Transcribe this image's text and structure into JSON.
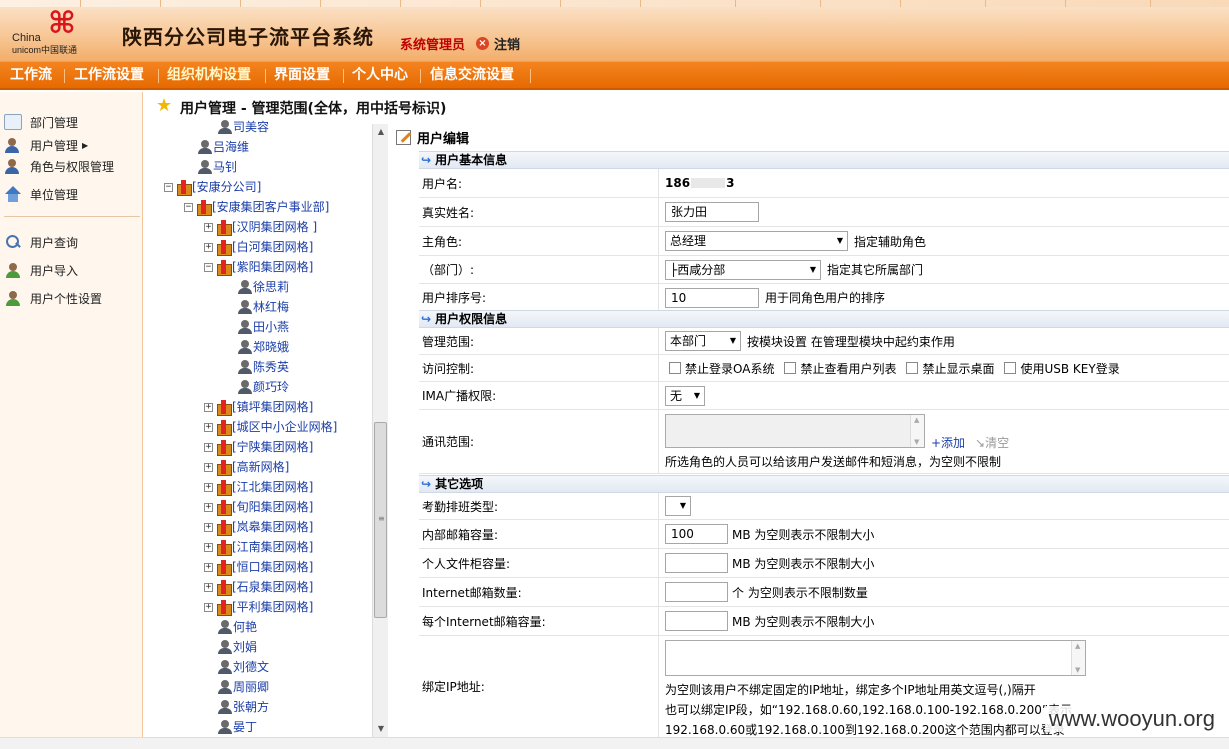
{
  "app": {
    "logo_text_1": "China",
    "logo_text_2": "unicom中国联通",
    "title": "陕西分公司电子流平台系统",
    "role": "系统管理员",
    "logout": "注销"
  },
  "menu": [
    {
      "label": "工作流",
      "active": false
    },
    {
      "label": "工作流设置",
      "active": false
    },
    {
      "label": "组织机构设置",
      "active": true
    },
    {
      "label": "界面设置",
      "active": false
    },
    {
      "label": "个人中心",
      "active": false
    },
    {
      "label": "信息交流设置",
      "active": false
    }
  ],
  "sidebar": {
    "items": [
      {
        "label": "部门管理",
        "icon": "department-icon"
      },
      {
        "label": "用户管理",
        "icon": "user-icon"
      },
      {
        "label": "角色与权限管理",
        "icon": "role-icon"
      },
      {
        "label": "单位管理",
        "icon": "home-icon"
      },
      {
        "label": "用户查询",
        "icon": "search-icon"
      },
      {
        "label": "用户导入",
        "icon": "import-icon"
      },
      {
        "label": "用户个性设置",
        "icon": "settings-icon"
      }
    ]
  },
  "header": {
    "title": "用户管理  - 管理范围(全体，用中括号标识)"
  },
  "tree": {
    "nodes": [
      {
        "label": "司美容",
        "type": "user",
        "level": 2
      },
      {
        "label": "吕海维",
        "type": "user",
        "level": 2
      },
      {
        "label": "马钊",
        "type": "user",
        "level": 2
      },
      {
        "label": "[安康分公司]",
        "type": "group",
        "level": 0,
        "toggle": "−"
      },
      {
        "label": "[安康集团客户事业部]",
        "type": "group",
        "level": 1,
        "toggle": "−"
      },
      {
        "label": "[汉阴集团网格  ]",
        "type": "group",
        "level": 2,
        "toggle": "+"
      },
      {
        "label": "[白河集团网格]",
        "type": "group",
        "level": 2,
        "toggle": "+"
      },
      {
        "label": "[紫阳集团网格]",
        "type": "group",
        "level": 2,
        "toggle": "−"
      },
      {
        "label": "徐思莉",
        "type": "user",
        "level": 3
      },
      {
        "label": "林红梅",
        "type": "user",
        "level": 3
      },
      {
        "label": "田小燕",
        "type": "user",
        "level": 3
      },
      {
        "label": "郑晓娥",
        "type": "user",
        "level": 3
      },
      {
        "label": "陈秀英",
        "type": "user",
        "level": 3
      },
      {
        "label": "颜巧玲",
        "type": "user",
        "level": 3
      },
      {
        "label": "[镇坪集团网格]",
        "type": "group",
        "level": 2,
        "toggle": "+"
      },
      {
        "label": "[城区中小企业网格]",
        "type": "group",
        "level": 2,
        "toggle": "+"
      },
      {
        "label": "[宁陕集团网格]",
        "type": "group",
        "level": 2,
        "toggle": "+"
      },
      {
        "label": "[高新网格]",
        "type": "group",
        "level": 2,
        "toggle": "+"
      },
      {
        "label": "[江北集团网格]",
        "type": "group",
        "level": 2,
        "toggle": "+"
      },
      {
        "label": "[旬阳集团网格]",
        "type": "group",
        "level": 2,
        "toggle": "+"
      },
      {
        "label": "[岚皋集团网格]",
        "type": "group",
        "level": 2,
        "toggle": "+"
      },
      {
        "label": "[江南集团网格]",
        "type": "group",
        "level": 2,
        "toggle": "+"
      },
      {
        "label": "[恒口集团网格]",
        "type": "group",
        "level": 2,
        "toggle": "+"
      },
      {
        "label": "[石泉集团网格]",
        "type": "group",
        "level": 2,
        "toggle": "+"
      },
      {
        "label": "[平利集团网格]",
        "type": "group",
        "level": 2,
        "toggle": "+"
      },
      {
        "label": "何艳",
        "type": "user",
        "level": 2
      },
      {
        "label": "刘娟",
        "type": "user",
        "level": 2
      },
      {
        "label": "刘德文",
        "type": "user",
        "level": 2
      },
      {
        "label": "周丽卿",
        "type": "user",
        "level": 2
      },
      {
        "label": "张朝方",
        "type": "user",
        "level": 2
      },
      {
        "label": "晏丁",
        "type": "user",
        "level": 2
      }
    ]
  },
  "form": {
    "title": "用户编辑",
    "section_basic": "用户基本信息",
    "section_perm": "用户权限信息",
    "section_other": "其它选项",
    "username_label": "用户名:",
    "username_prefix": "186",
    "username_suffix": "3",
    "realname_label": "真实姓名:",
    "realname_value": "张力田",
    "mainrole_label": "主角色:",
    "mainrole_value": "总经理",
    "mainrole_hint": "指定辅助角色",
    "dept_label": "（部门）:",
    "dept_value": "├西咸分部",
    "dept_hint": "指定其它所属部门",
    "sort_label": "用户排序号:",
    "sort_value": "10",
    "sort_hint": "用于同角色用户的排序",
    "scope_label": "管理范围:",
    "scope_value": "本部门",
    "scope_hint": "按模块设置  在管理型模块中起约束作用",
    "access_label": "访问控制:",
    "access_options": [
      "禁止登录OA系统",
      "禁止查看用户列表",
      "禁止显示桌面",
      "使用USB KEY登录"
    ],
    "ima_label": "IMA广播权限:",
    "ima_value": "无",
    "comm_label": "通讯范围:",
    "comm_add": "+添加",
    "comm_clear": "清空",
    "comm_hint": "所选角色的人员可以给该用户发送邮件和短消息，为空则不限制",
    "attend_label": "考勤排班类型:",
    "mailbox_label": "内部邮箱容量:",
    "mailbox_value": "100",
    "mailbox_hint": "MB 为空则表示不限制大小",
    "filecab_label": "个人文件柜容量:",
    "filecab_hint": "MB 为空则表示不限制大小",
    "inetcount_label": "Internet邮箱数量:",
    "inetcount_hint": "个  为空则表示不限制数量",
    "inetsize_label": "每个Internet邮箱容量:",
    "inetsize_hint": "MB 为空则表示不限制大小",
    "ip_label": "绑定IP地址:",
    "ip_hint_1": "为空则该用户不绑定固定的IP地址，绑定多个IP地址用英文逗号(,)隔开",
    "ip_hint_2": "也可以绑定IP段，如“192.168.0.60,192.168.0.100-192.168.0.200”表示",
    "ip_hint_3": "192.168.0.60或192.168.0.100到192.168.0.200这个范围内都可以登录"
  },
  "watermark": "www.wooyun.org"
}
